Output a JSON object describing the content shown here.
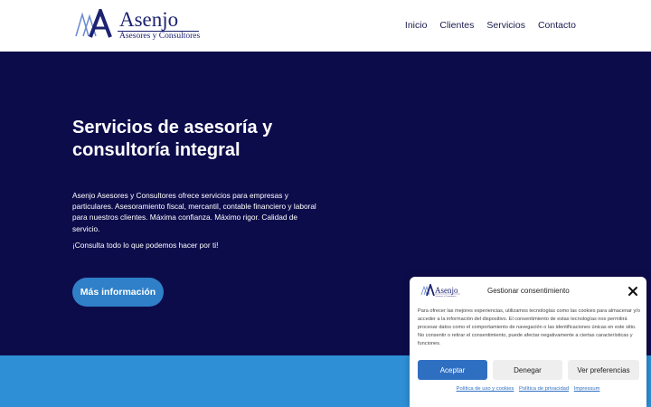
{
  "brand": {
    "name": "Asenjo",
    "subtitle": "Asesores y Consultores",
    "logo_color": "#1d2270",
    "logo_accent": "#6a8ad4"
  },
  "nav": {
    "items": [
      {
        "label": "Inicio"
      },
      {
        "label": "Clientes"
      },
      {
        "label": "Servicios"
      },
      {
        "label": "Contacto"
      }
    ]
  },
  "hero": {
    "title": "Servicios de asesoría y consultoría integral",
    "description": "Asenjo Asesores y Consultores ofrece servicios para empresas y particulares. Asesoramiento fiscal, mercantil, contable financiero y laboral para nuestros clientes. Máxima confianza. Máximo rigor. Calidad de servicio.",
    "cta_text": "¡Consulta todo lo que podemos hacer por ti!",
    "button_label": "Más información",
    "background": "#0d0c4b",
    "button_color": "#2f80c8"
  },
  "band": {
    "color": "#2e8fd6"
  },
  "consent": {
    "title": "Gestionar consentimiento",
    "close_icon": "close-icon",
    "text": "Para ofrecer las mejores experiencias, utilizamos tecnologías como las cookies para almacenar y/o acceder a la información del dispositivo. El consentimiento de estas tecnologías nos permitirá procesar datos como el comportamiento de navegación o las identificaciones únicas en este sitio. No consentir o retirar el consentimiento, puede afectar negativamente a ciertas características y funciones.",
    "accept_label": "Aceptar",
    "deny_label": "Denegar",
    "preferences_label": "Ver preferencias",
    "links": [
      {
        "label": "Política de uso y cookies"
      },
      {
        "label": "Política de privacidad"
      },
      {
        "label": "Impressum"
      }
    ],
    "accent": "#2f6fc2"
  }
}
